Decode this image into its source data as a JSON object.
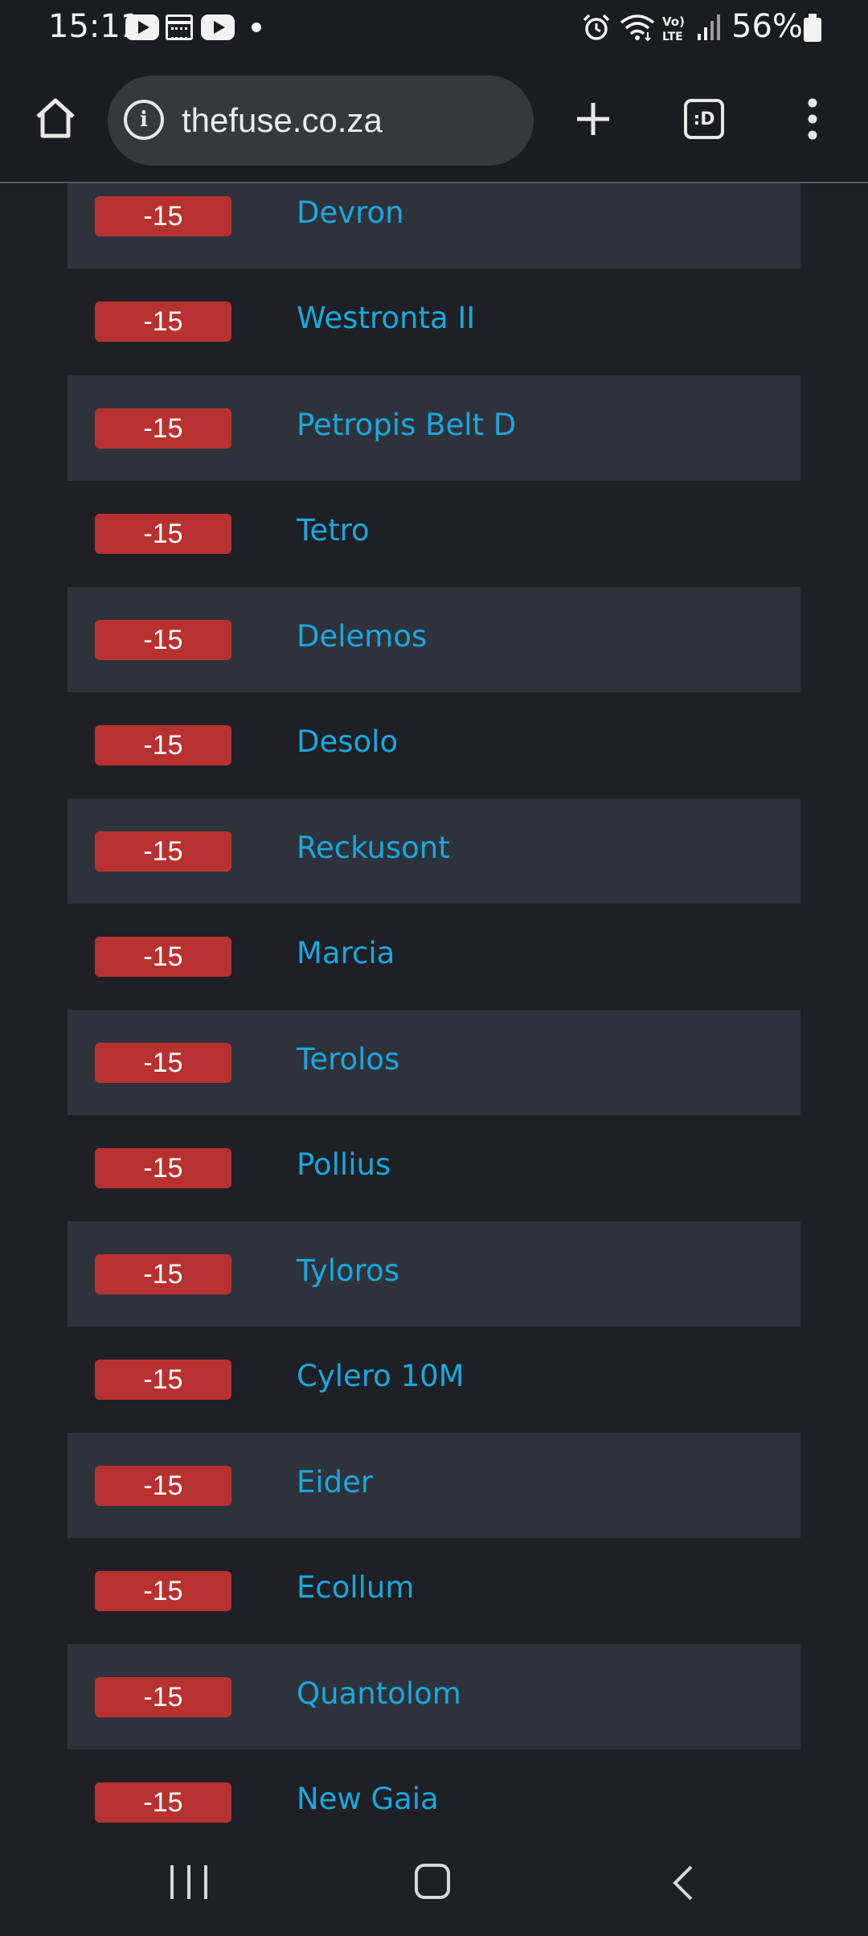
{
  "status_bar": {
    "time": "15:11",
    "battery": "56%",
    "icons": [
      "youtube-icon",
      "calendar-news-icon",
      "youtube-icon",
      "notification-dot-icon",
      "alarm-icon",
      "wifi-icon",
      "volte-icon",
      "signal-icon",
      "battery-icon"
    ]
  },
  "browser": {
    "url": "thefuse.co.za",
    "tabs_label": ":D"
  },
  "rows": [
    {
      "score": "-15",
      "name": "Devron"
    },
    {
      "score": "-15",
      "name": "Westronta II"
    },
    {
      "score": "-15",
      "name": "Petropis Belt D"
    },
    {
      "score": "-15",
      "name": "Tetro"
    },
    {
      "score": "-15",
      "name": "Delemos"
    },
    {
      "score": "-15",
      "name": "Desolo"
    },
    {
      "score": "-15",
      "name": "Reckusont"
    },
    {
      "score": "-15",
      "name": "Marcia"
    },
    {
      "score": "-15",
      "name": "Terolos"
    },
    {
      "score": "-15",
      "name": "Pollius"
    },
    {
      "score": "-15",
      "name": "Tyloros"
    },
    {
      "score": "-15",
      "name": "Cylero 10M"
    },
    {
      "score": "-15",
      "name": "Eider"
    },
    {
      "score": "-15",
      "name": "Ecollum"
    },
    {
      "score": "-15",
      "name": "Quantolom"
    },
    {
      "score": "-15",
      "name": "New Gaia"
    }
  ],
  "colors": {
    "badge": "#b83131",
    "link": "#1aa8de",
    "row_alt": "#2e333b",
    "background": "#1e2025"
  }
}
